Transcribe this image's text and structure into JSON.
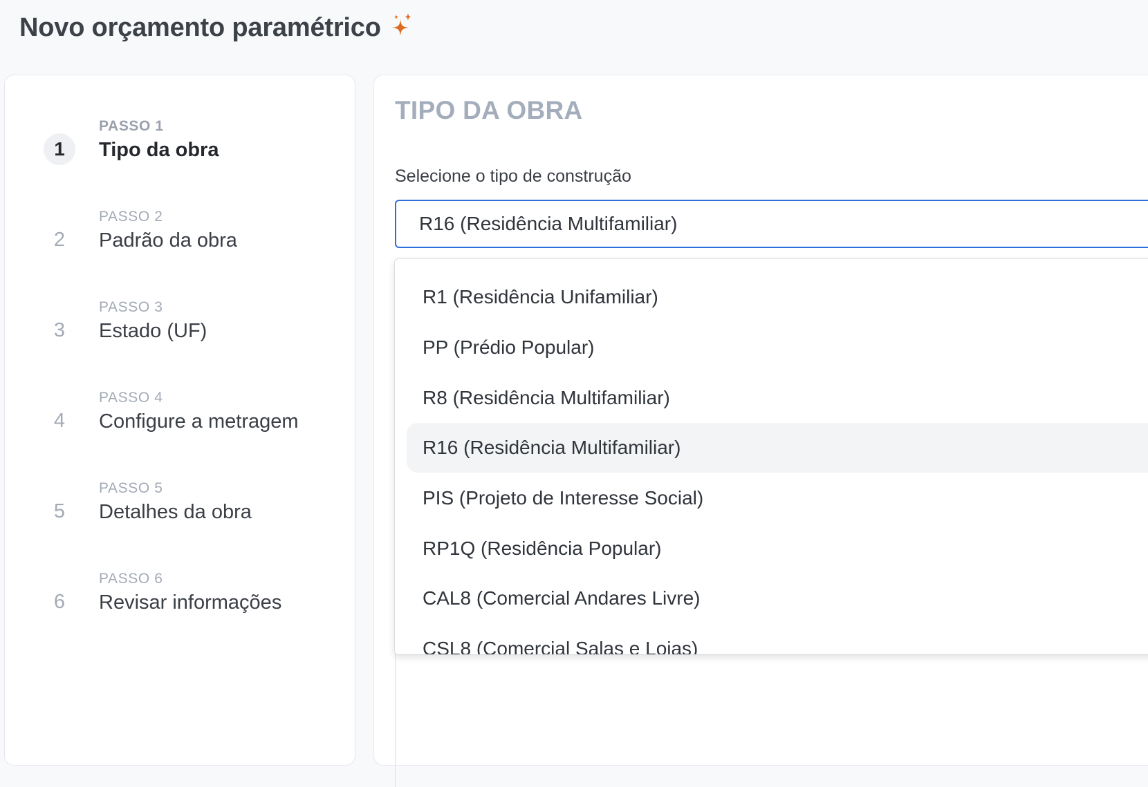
{
  "page": {
    "title": "Novo orçamento paramétrico",
    "title_icon": "sparkles-icon",
    "accent_color": "#e06a1d"
  },
  "stepper": {
    "steps": [
      {
        "eyebrow": "PASSO 1",
        "title": "Tipo da obra",
        "number": "1",
        "active": true
      },
      {
        "eyebrow": "PASSO 2",
        "title": "Padrão da obra",
        "number": "2",
        "active": false
      },
      {
        "eyebrow": "PASSO 3",
        "title": "Estado (UF)",
        "number": "3",
        "active": false
      },
      {
        "eyebrow": "PASSO 4",
        "title": "Configure a metragem",
        "number": "4",
        "active": false
      },
      {
        "eyebrow": "PASSO 5",
        "title": "Detalhes da obra",
        "number": "5",
        "active": false
      },
      {
        "eyebrow": "PASSO 6",
        "title": "Revisar informações",
        "number": "6",
        "active": false
      }
    ]
  },
  "main": {
    "section_title": "TIPO DA OBRA",
    "field_label": "Selecione o tipo de construção",
    "select_value": "R16 (Residência Multifamiliar)",
    "focus_color": "#2f6fdb"
  },
  "dropdown": {
    "options": [
      "R1 (Residência Unifamiliar)",
      "PP (Prédio Popular)",
      "R8 (Residência Multifamiliar)",
      "R16 (Residência Multifamiliar)",
      "PIS (Projeto de Interesse Social)",
      "RP1Q (Residência Popular)",
      "CAL8 (Comercial Andares Livre)",
      "CSL8 (Comercial Salas e Lojas)"
    ],
    "selected_index": 3
  }
}
